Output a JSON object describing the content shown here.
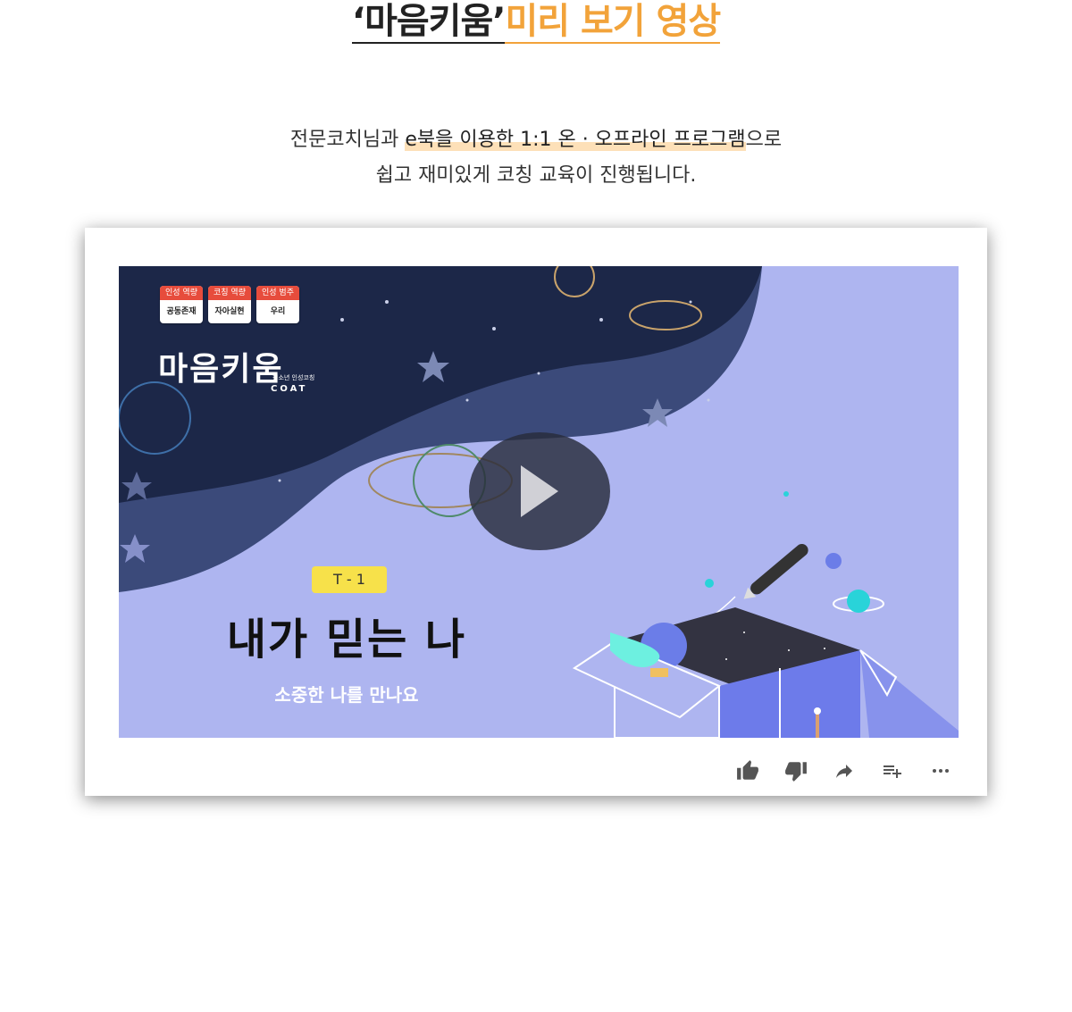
{
  "heading": {
    "part1": "‘마음키움’",
    "part2": "미리 보기 영상"
  },
  "description": {
    "line1_pre": "전문코치님과 ",
    "line1_highlight": "e북을 이용한 1:1 온 · 오프라인 프로그램",
    "line1_post": "으로",
    "line2": "쉽고 재미있게 코칭 교육이 진행됩니다."
  },
  "video": {
    "tags": [
      {
        "head": "인성 역량",
        "body": "공동존재"
      },
      {
        "head": "코칭 역량",
        "body": "자아실현"
      },
      {
        "head": "인성 범주",
        "body": "우리"
      }
    ],
    "logo": "마음키움",
    "logo_sub": "청소년 인성코칭",
    "logo_coat": "COAT",
    "badge": "T - 1",
    "title": "내가 믿는 나",
    "subtitle": "소중한 나를 만나요"
  },
  "actions": [
    "thumbs-up-icon",
    "thumbs-down-icon",
    "share-icon",
    "add-to-playlist-icon",
    "more-icon"
  ]
}
